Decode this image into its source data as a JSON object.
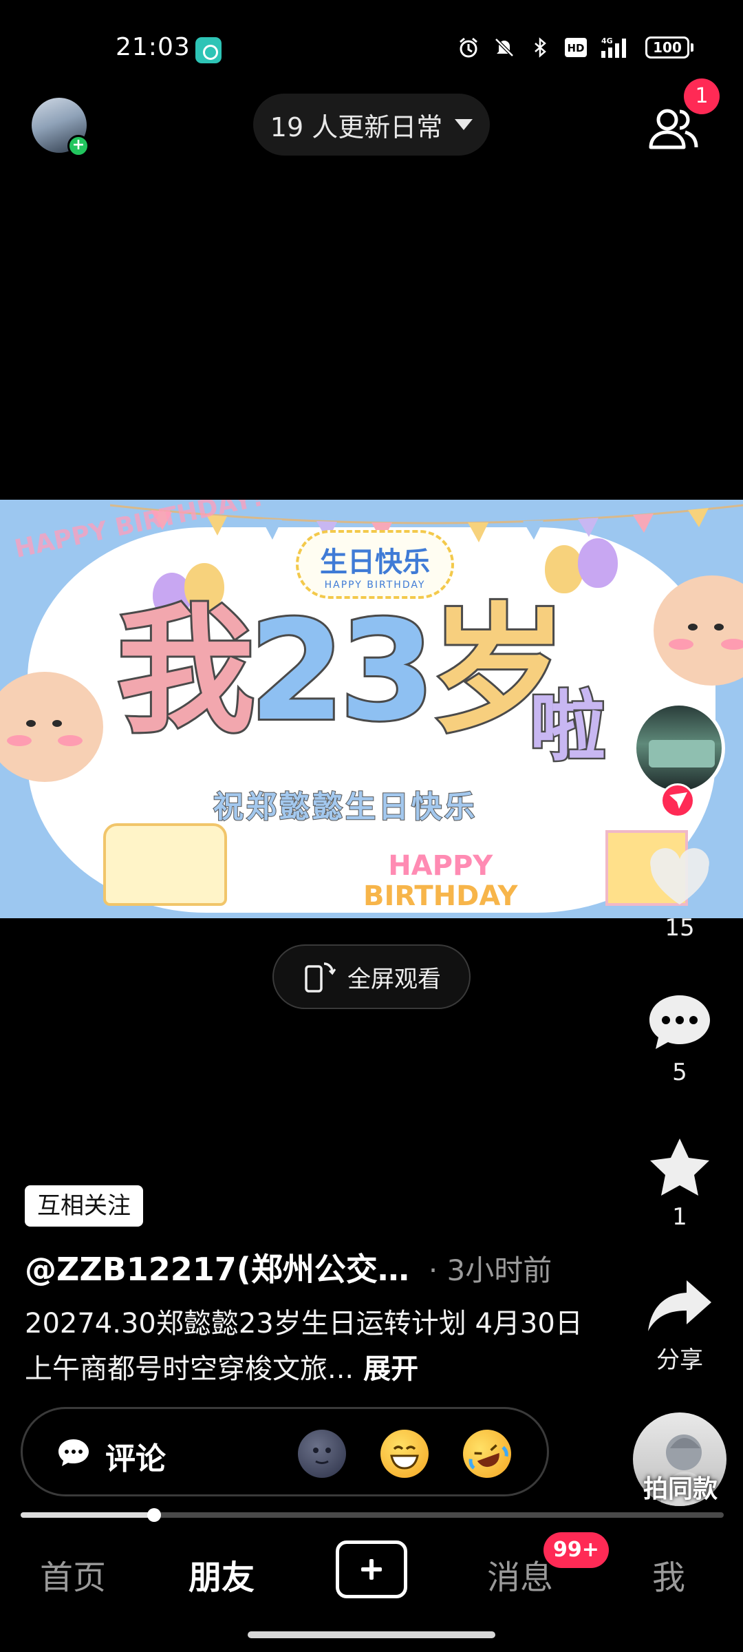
{
  "status_bar": {
    "time": "21:03",
    "icons": [
      "alarm-icon",
      "bell-muted-icon",
      "bluetooth-icon",
      "hd-icon",
      "signal-4g-icon",
      "battery-icon"
    ],
    "hd_label": "HD",
    "network_label": "4G",
    "battery_level": "100"
  },
  "top_nav": {
    "updates_label": "19 人更新日常",
    "friends_badge": "1"
  },
  "banner": {
    "corner_text": "HAPPY BIRTHDAY!",
    "title": "生日快乐",
    "title_sub": "HAPPY BIRTHDAY",
    "main_text": [
      "我",
      "2",
      "3",
      "岁"
    ],
    "main_suffix": "啦",
    "subtitle": "祝郑懿懿生日快乐",
    "hb_line1": "HAPPY",
    "hb_line2": "BIRTHDAY"
  },
  "fullscreen": {
    "label": "全屏观看"
  },
  "rail": {
    "like_count": "15",
    "comment_count": "5",
    "favorite_count": "1",
    "share_label": "分享",
    "same_style_label": "拍同款"
  },
  "post": {
    "relation_tag": "互相关注",
    "author": "@ZZB12217(郑州公交…",
    "time": "· 3小时前",
    "caption": "20274.30郑懿懿23岁生日运转计划 4月30日上午商都号时空穿梭文旅...",
    "expand_label": "展开"
  },
  "comment_bar": {
    "label": "评论",
    "emojis": [
      "new-moon-face-emoji",
      "grinning-face-emoji",
      "rolling-laughing-emoji"
    ]
  },
  "progress": {
    "fraction": 0.19
  },
  "bottom_nav": {
    "tabs": [
      "首页",
      "朋友",
      "消息",
      "我"
    ],
    "active_tab": "朋友",
    "messages_badge": "99+"
  },
  "colors": {
    "accent": "#ff2a55",
    "background": "#000000"
  }
}
